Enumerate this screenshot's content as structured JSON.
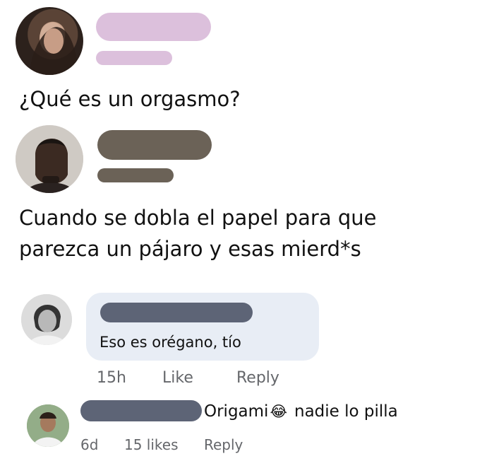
{
  "post1": {
    "text": "¿Qué es un orgasmo?",
    "name_redact_color": "#dcc0dc",
    "meta_redact_color": "#dcc0dc"
  },
  "post2": {
    "text_line1": "Cuando se dobla el papel para que",
    "text_line2": "parezca un pájaro y esas mierd*s",
    "name_redact_color": "#6b6257",
    "meta_redact_color": "#6b6257"
  },
  "comment1": {
    "text": "Eso es orégano, tío",
    "name_redact_color": "#5d6476",
    "time": "15h",
    "like_label": "Like",
    "reply_label": "Reply"
  },
  "comment2": {
    "text_before_emoji": "Origami",
    "emoji": "😂",
    "text_after_emoji": "nadie lo pilla",
    "name_redact_color": "#5d6476",
    "time": "6d",
    "likes": "15 likes",
    "reply_label": "Reply"
  }
}
